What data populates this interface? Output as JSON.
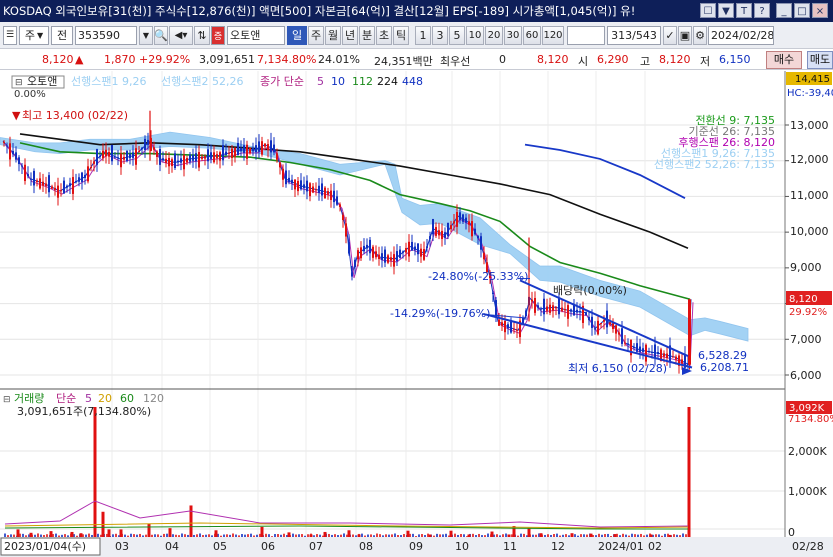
{
  "titlebar": {
    "text": "KOSDAQ 외국인보유[31(천)] 주식수[12,876(천)] 액면[500] 자본금[64(억)] 결산[12월] EPS[-189] 시가총액[1,045(억)] 유!",
    "controls": [
      "☐",
      "▼",
      "T",
      "?",
      "_",
      "□",
      "×"
    ]
  },
  "toolbar": {
    "market": "주",
    "type": "전",
    "code": "353590",
    "name": "오토앤",
    "mode": "일",
    "periods": [
      "주",
      "월",
      "년",
      "분",
      "초",
      "틱"
    ],
    "intervals": [
      "1",
      "3",
      "5",
      "10",
      "20",
      "30",
      "60",
      "120"
    ],
    "page": "313/543",
    "date": "2024/02/28"
  },
  "pricebar": {
    "price": "8,120",
    "change_arrow": "▲",
    "change": "1,870",
    "change_pct": "+29.92%",
    "volume": "3,091,651",
    "volume_pct": "7,134.80%",
    "turnover": "24.01%",
    "amount": "24,351백만",
    "pref_label": "최우선",
    "pref_value": "0",
    "ask": "8,120",
    "open_label": "시",
    "open": "6,290",
    "high_label": "고",
    "high": "8,120",
    "low_label": "저",
    "low": "6,150",
    "buy": "매수",
    "sell": "매도"
  },
  "legend": {
    "stock": "오토앤",
    "conv": "선행스팬1 9,26",
    "lag": "선행스팬2 52,26",
    "ma_label": "종가 단순",
    "ma": [
      "5",
      "10",
      "112",
      "224",
      "448"
    ],
    "pct": "0.00%"
  },
  "ichimoku_labels": [
    {
      "text": "전환선 9: 7,135",
      "color": "#1a9a1a"
    },
    {
      "text": "기준선 26: 7,135",
      "color": "#777777"
    },
    {
      "text": "후행스팬 26: 8,120",
      "color": "#b000b0"
    },
    {
      "text": "선행스팬1 9,26: 7,135",
      "color": "#9ccff2"
    },
    {
      "text": "선행스팬2 52,26: 7,135",
      "color": "#9ccff2"
    }
  ],
  "annotations": {
    "high": "최고 13,400 (02/22)",
    "drop1": "-24.80%(-25.33%)",
    "dividend": "배당락(0,00%)",
    "drop2": "-14.29%(-19.76%)",
    "line1": "6,528.29",
    "line2": "6,208.71",
    "low": "최저 6,150 (02/28)"
  },
  "price_axis": {
    "top_box": "14,415",
    "hc": "HC:-39,40",
    "ticks": [
      "13,000",
      "12,000",
      "11,000",
      "10,000",
      "9,000",
      "8,000",
      "7,000",
      "6,000"
    ],
    "cur_box": "8,120",
    "cur_pct": "29.92%"
  },
  "volume": {
    "label": "거래량",
    "ma_label": "단순",
    "ma": [
      "5",
      "20",
      "60",
      "120"
    ],
    "value": "3,091,651주(7,134.80%)",
    "box": "3,092K",
    "box_pct": "7134.80%",
    "ticks": [
      "2,000K",
      "1,000K",
      "0"
    ]
  },
  "xaxis": {
    "start": "2023/01/04(수)",
    "months": [
      "03",
      "04",
      "05",
      "06",
      "07",
      "08",
      "09",
      "10",
      "11",
      "12",
      "2024/01",
      "02"
    ],
    "end": "02/28"
  },
  "chart_data": {
    "type": "line",
    "ylim": [
      5600,
      14400
    ],
    "price_ticks": [
      13000,
      12000,
      11000,
      10000,
      9000,
      8000,
      7000,
      6000
    ],
    "volume_ylim": [
      0,
      3092000
    ],
    "volume_ticks": [
      2000000,
      1000000,
      0
    ],
    "kumo": [
      [
        0,
        12450,
        12650
      ],
      [
        35,
        12250,
        12500
      ],
      [
        60,
        12200,
        12500
      ],
      [
        90,
        12300,
        12600
      ],
      [
        130,
        12600,
        12300
      ],
      [
        170,
        12400,
        12800
      ],
      [
        210,
        12350,
        12650
      ],
      [
        260,
        12350,
        12200
      ],
      [
        300,
        11900,
        12200
      ],
      [
        340,
        11600,
        11900
      ],
      [
        385,
        12000,
        11900
      ],
      [
        395,
        11900,
        11100
      ],
      [
        402,
        10550,
        10950
      ],
      [
        420,
        10750,
        10200
      ],
      [
        440,
        10800,
        10250
      ],
      [
        480,
        10400,
        9650
      ],
      [
        510,
        9400,
        9650
      ],
      [
        540,
        8650,
        9050
      ],
      [
        560,
        8600,
        9050
      ],
      [
        600,
        8650,
        8200
      ],
      [
        640,
        7900,
        8350
      ],
      [
        690,
        7100,
        7550
      ],
      [
        705,
        7250,
        7600
      ],
      [
        720,
        7150,
        7500
      ],
      [
        748,
        6950,
        7300
      ]
    ],
    "close": [
      [
        3,
        12550
      ],
      [
        15,
        12150
      ],
      [
        30,
        11500
      ],
      [
        45,
        11350
      ],
      [
        60,
        11150
      ],
      [
        72,
        11350
      ],
      [
        85,
        11550
      ],
      [
        95,
        12000
      ],
      [
        105,
        12250
      ],
      [
        120,
        12050
      ],
      [
        135,
        12150
      ],
      [
        150,
        12550
      ],
      [
        160,
        12050
      ],
      [
        175,
        11950
      ],
      [
        190,
        12050
      ],
      [
        205,
        12100
      ],
      [
        220,
        12150
      ],
      [
        240,
        12300
      ],
      [
        255,
        12300
      ],
      [
        265,
        12450
      ],
      [
        275,
        12300
      ],
      [
        285,
        11500
      ],
      [
        300,
        11300
      ],
      [
        315,
        11200
      ],
      [
        330,
        11100
      ],
      [
        340,
        10750
      ],
      [
        347,
        10000
      ],
      [
        352,
        8800
      ],
      [
        358,
        9400
      ],
      [
        368,
        9600
      ],
      [
        380,
        9300
      ],
      [
        395,
        9250
      ],
      [
        410,
        9600
      ],
      [
        425,
        9400
      ],
      [
        433,
        10100
      ],
      [
        445,
        9900
      ],
      [
        458,
        10450
      ],
      [
        470,
        10250
      ],
      [
        480,
        9750
      ],
      [
        490,
        8750
      ],
      [
        498,
        7500
      ],
      [
        508,
        7350
      ],
      [
        518,
        7250
      ],
      [
        525,
        7600
      ],
      [
        530,
        8150
      ],
      [
        540,
        7850
      ],
      [
        555,
        7900
      ],
      [
        570,
        7800
      ],
      [
        585,
        7750
      ],
      [
        595,
        7300
      ],
      [
        605,
        7550
      ],
      [
        615,
        7350
      ],
      [
        625,
        6900
      ],
      [
        640,
        6700
      ],
      [
        660,
        6600
      ],
      [
        675,
        6500
      ],
      [
        688,
        6300
      ],
      [
        691,
        8120
      ]
    ],
    "ma112": [
      [
        20,
        12500
      ],
      [
        60,
        12250
      ],
      [
        100,
        12200
      ],
      [
        150,
        12200
      ],
      [
        200,
        12150
      ],
      [
        250,
        12100
      ],
      [
        290,
        11950
      ],
      [
        330,
        11750
      ],
      [
        370,
        11450
      ],
      [
        400,
        11050
      ],
      [
        440,
        10800
      ],
      [
        470,
        10600
      ],
      [
        500,
        10300
      ],
      [
        530,
        9600
      ],
      [
        560,
        9150
      ],
      [
        600,
        8850
      ],
      [
        640,
        8500
      ],
      [
        690,
        8120
      ]
    ],
    "ma224": [
      [
        20,
        12750
      ],
      [
        60,
        12600
      ],
      [
        100,
        12450
      ],
      [
        150,
        12500
      ],
      [
        200,
        12450
      ],
      [
        250,
        12350
      ],
      [
        300,
        12250
      ],
      [
        350,
        12050
      ],
      [
        400,
        11850
      ],
      [
        450,
        11600
      ],
      [
        500,
        11350
      ],
      [
        550,
        11050
      ],
      [
        600,
        10500
      ],
      [
        650,
        10000
      ],
      [
        688,
        9550
      ]
    ],
    "ma448": [
      [
        525,
        12450
      ],
      [
        560,
        12300
      ],
      [
        600,
        12050
      ],
      [
        640,
        11600
      ],
      [
        685,
        10950
      ]
    ],
    "channel_upper": [
      [
        520,
        8650
      ],
      [
        688,
        6530
      ]
    ],
    "channel_lower": [
      [
        485,
        7700
      ],
      [
        692,
        6210
      ]
    ],
    "volume_bars": [
      [
        18,
        180000
      ],
      [
        31,
        100000
      ],
      [
        51,
        140000
      ],
      [
        72,
        120000
      ],
      [
        81,
        90000
      ],
      [
        95,
        3092000
      ],
      [
        103,
        600000
      ],
      [
        109,
        180000
      ],
      [
        121,
        180000
      ],
      [
        149,
        320000
      ],
      [
        170,
        210000
      ],
      [
        191,
        750000
      ],
      [
        216,
        160000
      ],
      [
        262,
        240000
      ],
      [
        289,
        110000
      ],
      [
        311,
        60000
      ],
      [
        325,
        120000
      ],
      [
        349,
        160000
      ],
      [
        359,
        60000
      ],
      [
        408,
        150000
      ],
      [
        430,
        60000
      ],
      [
        451,
        150000
      ],
      [
        469,
        60000
      ],
      [
        492,
        130000
      ],
      [
        509,
        60000
      ],
      [
        514,
        260000
      ],
      [
        529,
        200000
      ],
      [
        541,
        90000
      ],
      [
        572,
        90000
      ],
      [
        591,
        80000
      ],
      [
        615,
        70000
      ],
      [
        651,
        60000
      ],
      [
        670,
        50000
      ],
      [
        689,
        3092000
      ]
    ]
  }
}
